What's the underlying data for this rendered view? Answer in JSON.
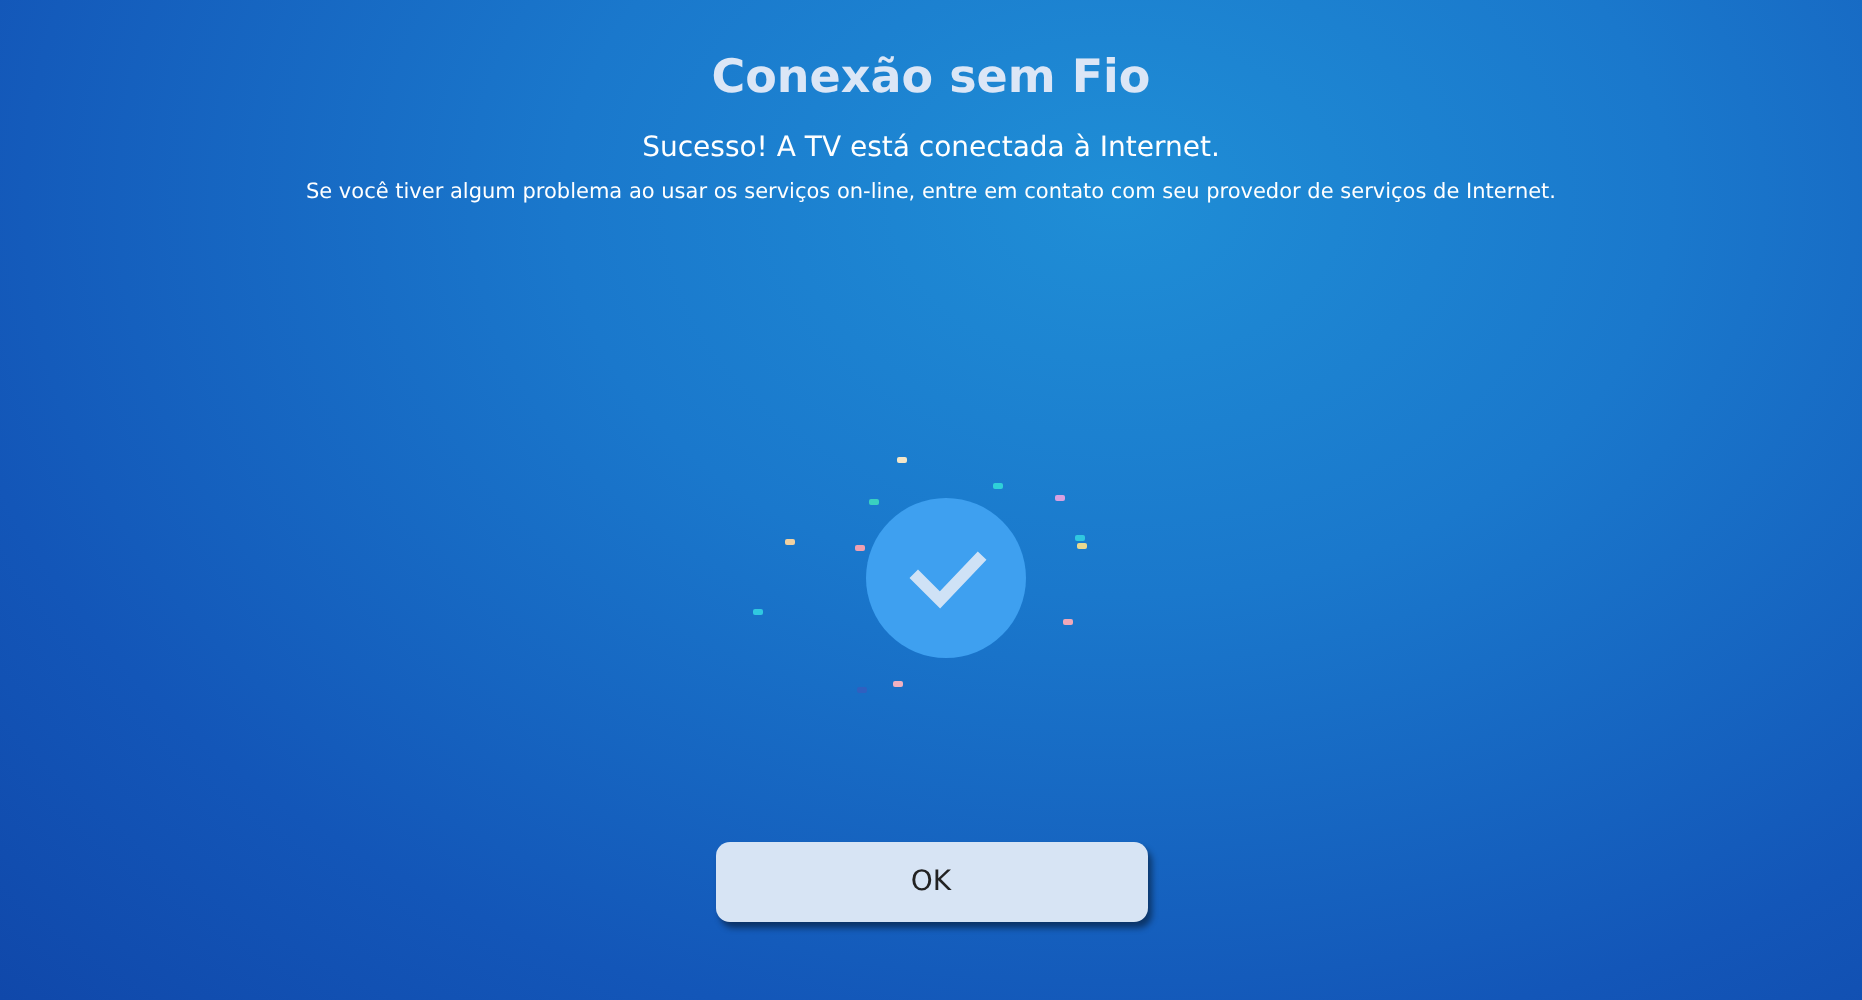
{
  "title": "Conexão sem Fio",
  "message": "Sucesso! A TV está conectada à Internet.",
  "note": "Se você tiver algum problema ao usar os serviços on-line, entre em contato com seu provedor de serviços de Internet.",
  "button": {
    "label": "OK",
    "selected": true
  }
}
